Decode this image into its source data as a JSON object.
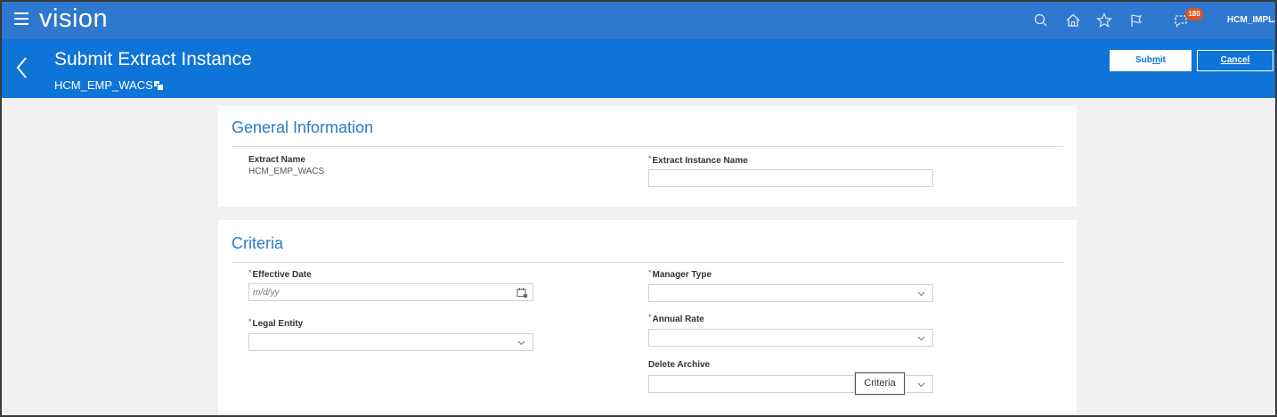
{
  "topbar": {
    "brand": "vision",
    "notification_count": "180",
    "user": "HCM_IMPL",
    "icons": [
      "search-icon",
      "home-icon",
      "star-icon",
      "flag-icon",
      "notifications-icon"
    ]
  },
  "header": {
    "title": "Submit Extract Instance",
    "subtitle": "HCM_EMP_WACS",
    "submit_label_pre": "Sub",
    "submit_label_u": "m",
    "submit_label_post": "it",
    "cancel_label": "Cancel"
  },
  "general": {
    "heading": "General Information",
    "extract_name_label": "Extract Name",
    "extract_name_value": "HCM_EMP_WACS",
    "instance_name_label": "Extract Instance Name",
    "instance_name_value": ""
  },
  "criteria": {
    "heading": "Criteria",
    "effective_date_label": "Effective Date",
    "effective_date_placeholder": "m/d/yy",
    "legal_entity_label": "Legal Entity",
    "manager_type_label": "Manager Type",
    "annual_rate_label": "Annual Rate",
    "delete_archive_label": "Delete Archive",
    "required_mark": "*"
  },
  "tooltip": {
    "text": "Criteria"
  },
  "colors": {
    "topbar": "#2f78cf",
    "header": "#0f74d7",
    "heading_text": "#2a7ccc",
    "badge": "#d9541e",
    "required": "#c0392b"
  }
}
